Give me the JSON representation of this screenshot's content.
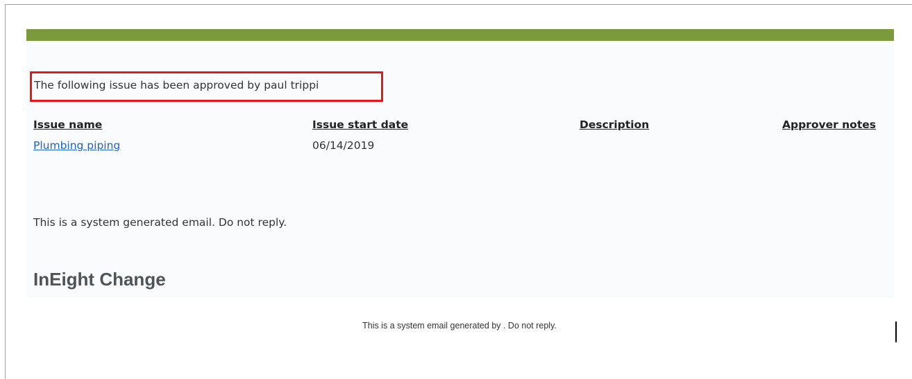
{
  "email": {
    "approval_message": "The following issue has been approved by paul trippi",
    "table": {
      "headers": [
        "Issue name",
        "Issue start date",
        "Description",
        "Approver notes"
      ],
      "rows": [
        {
          "issue_name": "Plumbing piping",
          "issue_start_date": "06/14/2019",
          "description": "",
          "approver_notes": ""
        }
      ]
    },
    "system_note": "This is a system generated email. Do not reply.",
    "brand_name": "InEight Change",
    "footer_note": "This is a system email generated by . Do not reply."
  },
  "colors": {
    "accent_bar": "#7a9a3c",
    "highlight_border": "#e8161c",
    "link": "#1a64c8",
    "brand_text": "#4e5456"
  }
}
